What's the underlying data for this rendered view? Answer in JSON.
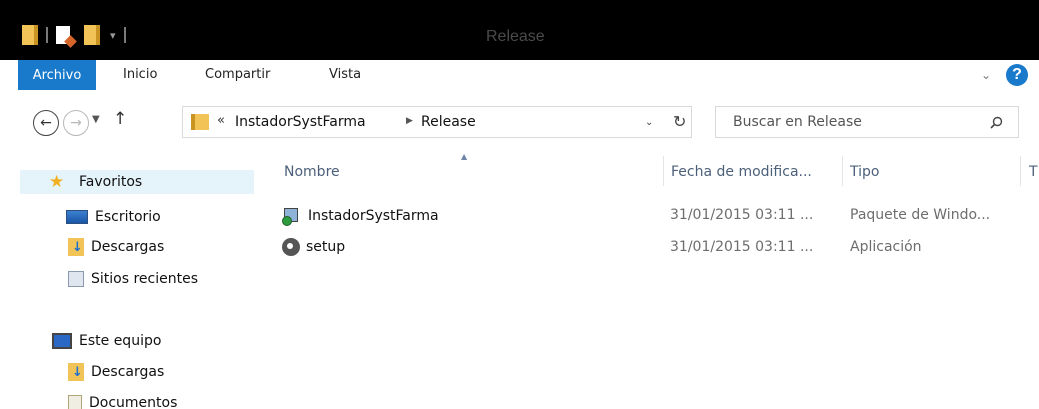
{
  "window": {
    "title": "Release"
  },
  "ribbon": {
    "tabs": [
      {
        "label": "Archivo"
      },
      {
        "label": "Inicio"
      },
      {
        "label": "Compartir"
      },
      {
        "label": "Vista"
      }
    ],
    "help_label": "?"
  },
  "address": {
    "overflow": "«",
    "crumbs": [
      "InstadorSystFarma",
      "Release"
    ]
  },
  "search": {
    "placeholder": "Buscar en Release"
  },
  "navpane": {
    "favorites": {
      "label": "Favoritos",
      "items": [
        {
          "label": "Escritorio",
          "icon": "desktop-icon"
        },
        {
          "label": "Descargas",
          "icon": "download-folder-icon"
        },
        {
          "label": "Sitios recientes",
          "icon": "recent-places-icon"
        }
      ]
    },
    "computer": {
      "label": "Este equipo",
      "items": [
        {
          "label": "Descargas",
          "icon": "download-folder-icon"
        },
        {
          "label": "Documentos",
          "icon": "documents-icon"
        }
      ]
    }
  },
  "filelist": {
    "columns": [
      "Nombre",
      "Fecha de modifica...",
      "Tipo",
      "T"
    ],
    "rows": [
      {
        "name": "InstadorSystFarma",
        "date": "31/01/2015 03:11 ...",
        "type": "Paquete de Windo...",
        "icon": "msi-package-icon"
      },
      {
        "name": "setup",
        "date": "31/01/2015 03:11 ...",
        "type": "Aplicación",
        "icon": "setup-app-icon"
      }
    ]
  },
  "colors": {
    "accent": "#1979ca",
    "titlebar": "#000000",
    "selection": "#e5f3fb",
    "header_text": "#4c607a"
  }
}
